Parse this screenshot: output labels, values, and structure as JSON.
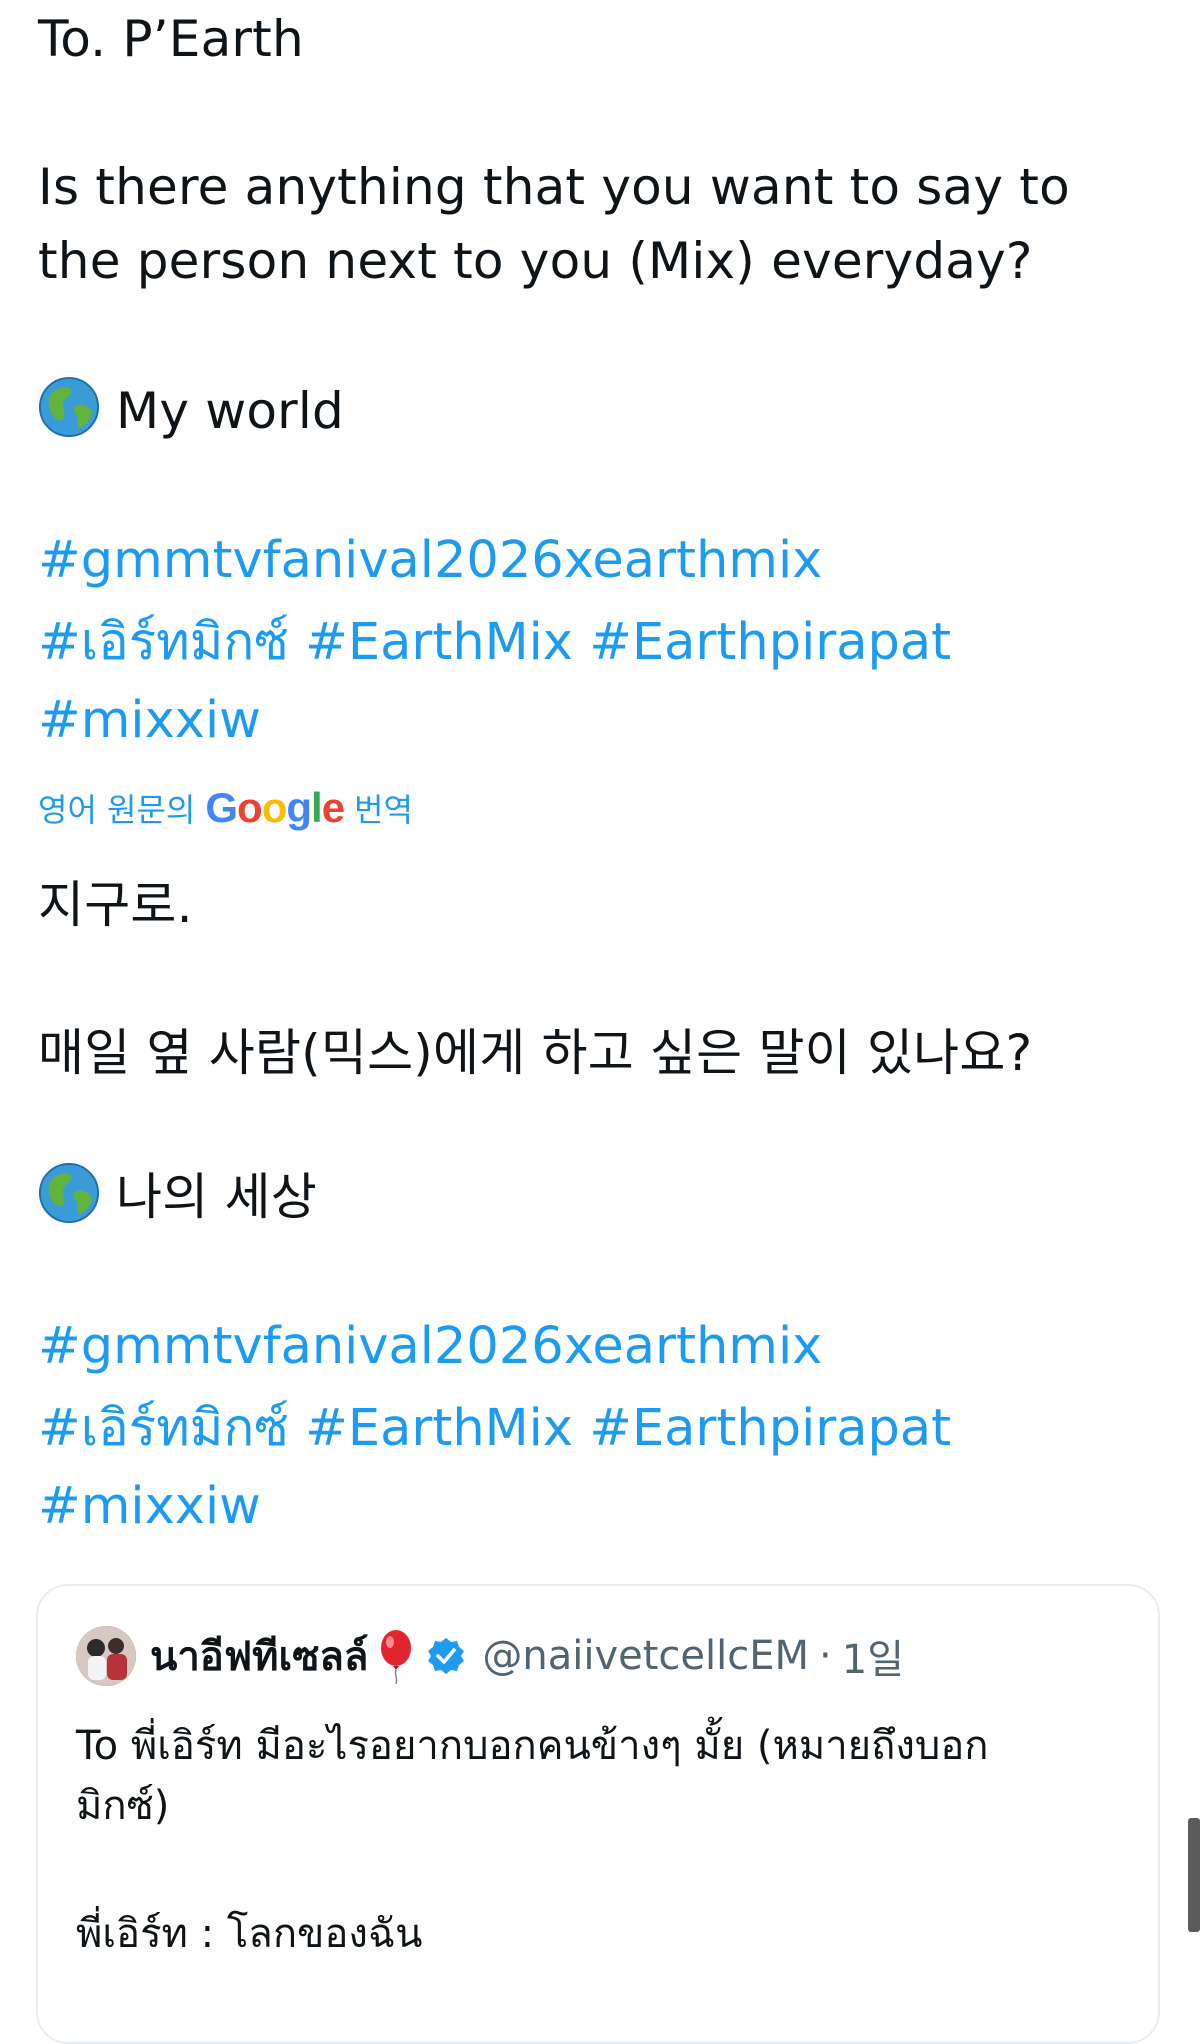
{
  "original": {
    "line1": "To. P’Earth",
    "question_line1": "Is there anything that you want to say to",
    "question_line2": "the person next to you (Mix) everyday?",
    "answer": "My world",
    "hashtags_line1": [
      "#gmmtvfanival2026xearthmix"
    ],
    "hashtags_line2": [
      "#เอิร์ทมิกซ์",
      "#EarthMix",
      "#Earthpirapat"
    ],
    "hashtags_line3": [
      "#mixxiw"
    ]
  },
  "translation_bar": {
    "prefix": "영어 원문의",
    "google_letters": [
      "G",
      "o",
      "o",
      "g",
      "l",
      "e"
    ],
    "suffix": "번역"
  },
  "translated": {
    "line1": "지구로.",
    "question": "매일 옆 사람(믹스)에게 하고 싶은 말이 있나요?",
    "answer": "나의 세상",
    "hashtags_line1": [
      "#gmmtvfanival2026xearthmix"
    ],
    "hashtags_line2": [
      "#เอิร์ทมิกซ์",
      "#EarthMix",
      "#Earthpirapat"
    ],
    "hashtags_line3": [
      "#mixxiw"
    ]
  },
  "quote": {
    "name": "นาอีฟทีเซลล์",
    "handle": "@naiivetcellcEM",
    "separator": "·",
    "time": "1일",
    "text_line1": "To พี่เอิร์ท มีอะไรอยากบอกคนข้างๆ มั้ย (หมายถึงบอก",
    "text_line2": "มิกซ์)",
    "text_line3": "พี่เอิร์ท : โลกของฉัน"
  },
  "icons": {
    "globe": "globe-emoji-icon",
    "balloon": "balloon-emoji-icon",
    "verified": "verified-badge-icon"
  },
  "colors": {
    "text": "#0f1419",
    "link": "#1d9bf0",
    "muted": "#536471",
    "border": "#e6ecf0",
    "google_blue": "#4285f4",
    "google_red": "#ea4335",
    "google_yellow": "#fbbc05",
    "google_green": "#34a853"
  }
}
